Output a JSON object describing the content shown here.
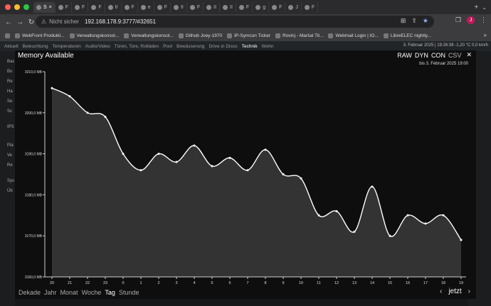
{
  "browser": {
    "tabs": [
      {
        "label": "S",
        "active": true
      },
      {
        "label": "F",
        "active": false
      },
      {
        "label": "F",
        "active": false
      },
      {
        "label": "F",
        "active": false
      },
      {
        "label": "II",
        "active": false
      },
      {
        "label": "F",
        "active": false
      },
      {
        "label": "e",
        "active": false
      },
      {
        "label": "F",
        "active": false
      },
      {
        "label": "II",
        "active": false
      },
      {
        "label": "F",
        "active": false
      },
      {
        "label": "II",
        "active": false
      },
      {
        "label": "II",
        "active": false
      },
      {
        "label": "F",
        "active": false
      },
      {
        "label": "g",
        "active": false
      },
      {
        "label": "F",
        "active": false
      },
      {
        "label": "J",
        "active": false
      },
      {
        "label": "F",
        "active": false
      }
    ],
    "not_secure": "Nicht sicher",
    "url": "192.168.178.9:3777/#32651",
    "bookmarks": [
      {
        "label": "WebFront Produkti..."
      },
      {
        "label": "Verwaltungskonsol..."
      },
      {
        "label": "Verwaltungskonsol..."
      },
      {
        "label": "Github Joey-1970"
      },
      {
        "label": "IP-Symcon Ticker"
      },
      {
        "label": "Rovinj - Maršal Tit..."
      },
      {
        "label": "Webmail Login | IO..."
      },
      {
        "label": "LibreELEC nightly..."
      }
    ],
    "avatar_letter": "J"
  },
  "app": {
    "nav": [
      "Aktuell",
      "Beleuchtung",
      "Temperaturen",
      "Audio/Video",
      "Türen, Tore, Rolläden",
      "Pool",
      "Bewässerung",
      "Drive in Disco",
      "Technik",
      "Wohn"
    ],
    "active_nav": "Technik",
    "status": "3. Februar 2025 | 19:26:38  -1,20 °C  0,0 km/h",
    "left_labels": [
      "Bas",
      "Bo",
      "Re",
      "Ha",
      "Se",
      "Sc",
      "IPS",
      "Pla",
      "Ve",
      "Re",
      "Sys",
      "Üb"
    ]
  },
  "dialog": {
    "title": "Memory Available",
    "modes": [
      "RAW",
      "DYN",
      "CON",
      "CSV"
    ],
    "active_modes": [
      "RAW",
      "DYN",
      "CON"
    ],
    "date_range": "bis 3. Februar 2025 19:00",
    "periods": [
      "Dekade",
      "Jahr",
      "Monat",
      "Woche",
      "Tag",
      "Stunde"
    ],
    "active_period": "Tag",
    "pager": {
      "prev": "‹",
      "now": "jetzt",
      "next": "›"
    },
    "close": "✕"
  },
  "chart_data": {
    "type": "area",
    "title": "Memory Available",
    "xlabel": "",
    "ylabel": "",
    "ylim": [
      3160,
      3210
    ],
    "ytick_labels": [
      "3160,0 MB",
      "3170,0 MB",
      "3180,0 MB",
      "3190,0 MB",
      "3200,0 MB",
      "3210,0 MB"
    ],
    "x": [
      "20",
      "21",
      "22",
      "23",
      "0",
      "1",
      "2",
      "3",
      "4",
      "5",
      "6",
      "7",
      "8",
      "9",
      "10",
      "11",
      "12",
      "13",
      "14",
      "15",
      "16",
      "17",
      "18",
      "19"
    ],
    "grid": false,
    "series": [
      {
        "values": [
          3206,
          3204,
          3200,
          3199,
          3190,
          3186,
          3190,
          3188,
          3192,
          3187,
          3189,
          3186,
          3191,
          3185,
          3184,
          3175,
          3176,
          3171,
          3182,
          3170,
          3175,
          3173,
          3175,
          3169
        ]
      }
    ],
    "colors": {
      "line": "#ffffff",
      "fill": "#3a3a3a"
    }
  }
}
